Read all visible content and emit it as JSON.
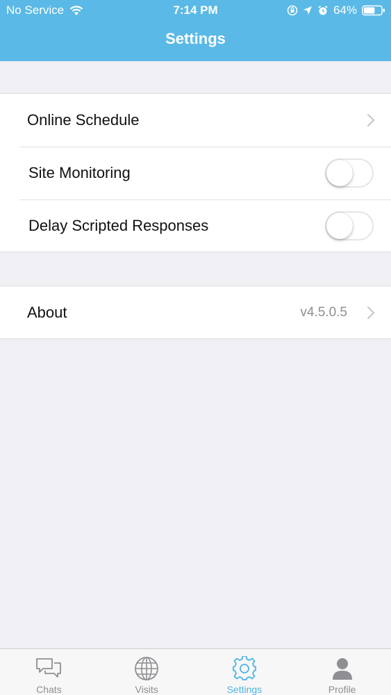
{
  "status_bar": {
    "carrier": "No Service",
    "time": "7:14 PM",
    "battery": "64%",
    "battery_level": 0.64,
    "icons": [
      "wifi-icon",
      "screen-lock-icon",
      "location-icon",
      "alarm-icon",
      "battery-icon"
    ]
  },
  "header": {
    "title": "Settings",
    "color": "#5ab9e6"
  },
  "settings": {
    "group1": [
      {
        "label": "Online Schedule",
        "type": "link"
      },
      {
        "label": "Site Monitoring",
        "type": "toggle",
        "on": false
      },
      {
        "label": "Delay Scripted Responses",
        "type": "toggle",
        "on": false
      }
    ],
    "group2": [
      {
        "label": "About",
        "value": "v4.5.0.5",
        "type": "link"
      }
    ]
  },
  "tab_bar": {
    "active_color": "#4fb3e3",
    "tabs": [
      {
        "label": "Chats",
        "icon": "chat-bubbles-icon",
        "active": false
      },
      {
        "label": "Visits",
        "icon": "globe-icon",
        "active": false
      },
      {
        "label": "Settings",
        "icon": "gear-icon",
        "active": true
      },
      {
        "label": "Profile",
        "icon": "person-icon",
        "active": false
      }
    ]
  }
}
